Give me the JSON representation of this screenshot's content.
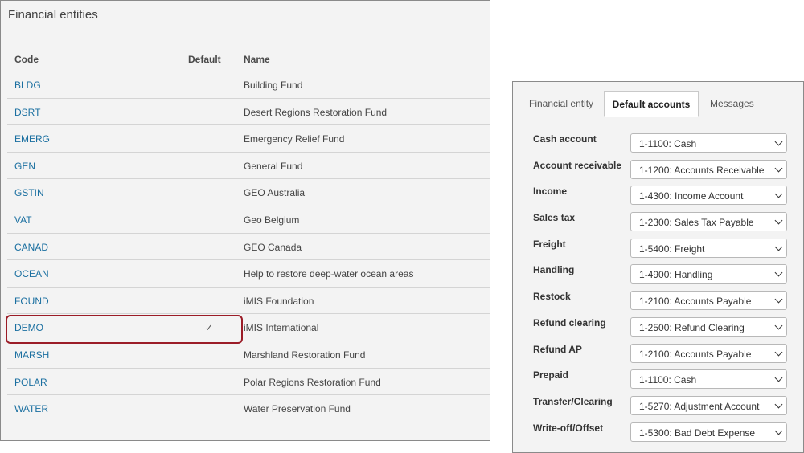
{
  "financial_entities": {
    "title": "Financial entities",
    "columns": {
      "code": "Code",
      "default": "Default",
      "name": "Name"
    },
    "rows": [
      {
        "code": "BLDG",
        "default": "",
        "name": "Building Fund"
      },
      {
        "code": "DSRT",
        "default": "",
        "name": "Desert Regions Restoration Fund"
      },
      {
        "code": "EMERG",
        "default": "",
        "name": "Emergency Relief Fund"
      },
      {
        "code": "GEN",
        "default": "",
        "name": "General Fund"
      },
      {
        "code": "GSTIN",
        "default": "",
        "name": "GEO Australia"
      },
      {
        "code": "VAT",
        "default": "",
        "name": "Geo Belgium"
      },
      {
        "code": "CANAD",
        "default": "",
        "name": "GEO Canada"
      },
      {
        "code": "OCEAN",
        "default": "",
        "name": "Help to restore deep-water ocean areas"
      },
      {
        "code": "FOUND",
        "default": "",
        "name": "iMIS Foundation"
      },
      {
        "code": "DEMO",
        "default": "✓",
        "name": "iMIS International",
        "highlight": true
      },
      {
        "code": "MARSH",
        "default": "",
        "name": "Marshland Restoration Fund"
      },
      {
        "code": "POLAR",
        "default": "",
        "name": "Polar Regions Restoration Fund"
      },
      {
        "code": "WATER",
        "default": "",
        "name": "Water Preservation Fund"
      }
    ]
  },
  "default_accounts": {
    "tabs": [
      {
        "label": "Financial entity",
        "active": false
      },
      {
        "label": "Default accounts",
        "active": true
      },
      {
        "label": "Messages",
        "active": false
      }
    ],
    "fields": [
      {
        "label": "Cash account",
        "value": "1-1100: Cash"
      },
      {
        "label": "Account receivable",
        "value": "1-1200: Accounts Receivable"
      },
      {
        "label": "Income",
        "value": "1-4300: Income Account"
      },
      {
        "label": "Sales tax",
        "value": "1-2300: Sales Tax Payable"
      },
      {
        "label": "Freight",
        "value": "1-5400: Freight"
      },
      {
        "label": "Handling",
        "value": "1-4900: Handling"
      },
      {
        "label": "Restock",
        "value": "1-2100: Accounts Payable"
      },
      {
        "label": "Refund clearing",
        "value": "1-2500: Refund Clearing"
      },
      {
        "label": "Refund AP",
        "value": "1-2100: Accounts Payable"
      },
      {
        "label": "Prepaid",
        "value": "1-1100: Cash"
      },
      {
        "label": "Transfer/Clearing",
        "value": "1-5270: Adjustment Account"
      },
      {
        "label": "Write-off/Offset",
        "value": "1-5300: Bad Debt Expense"
      }
    ]
  },
  "colors": {
    "link": "#1a6fa0",
    "highlight_border": "#9b1c27",
    "panel_bg": "#f3f3f3"
  }
}
